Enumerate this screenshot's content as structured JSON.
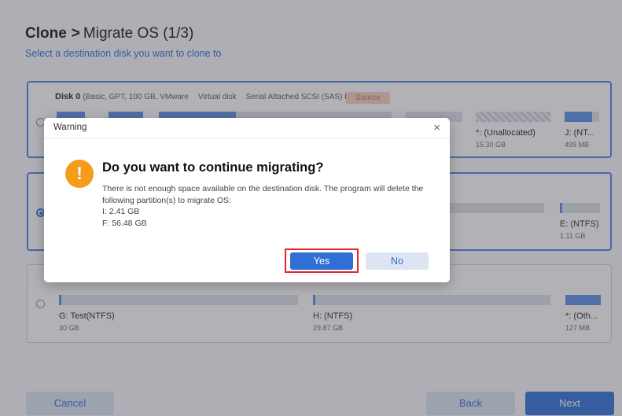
{
  "header": {
    "title_bold": "Clone",
    "arrow": ">",
    "title_rest": "Migrate OS (1/3)",
    "subtitle": "Select a destination disk you want to clone to"
  },
  "disks": [
    {
      "name": "Disk 0",
      "details": "(Basic, GPT, 100 GB, VMware",
      "type": "Virtual disk",
      "bus": "Serial Attached SCSI (SAS) bus)",
      "badge": "Source",
      "partitions": [
        {
          "label": "*: (Unallocated)",
          "size": "15.30 GB"
        },
        {
          "label": "J: (NT...",
          "size": "499 MB"
        }
      ]
    },
    {
      "partitions": [
        {
          "label": "E: (NTFS)",
          "size": "1.11 GB"
        }
      ]
    },
    {
      "partitions": [
        {
          "label": "G: Test(NTFS)",
          "size": "30 GB"
        },
        {
          "label": "H: (NTFS)",
          "size": "29.87 GB"
        },
        {
          "label": "*: (Oth...",
          "size": "127 MB"
        }
      ]
    }
  ],
  "footer": {
    "cancel": "Cancel",
    "back": "Back",
    "next": "Next"
  },
  "dialog": {
    "title": "Warning",
    "close": "×",
    "icon": "exclamation-icon",
    "icon_glyph": "!",
    "heading": "Do you want to continue migrating?",
    "message": "There is not enough space available on the destination disk. The program will delete the following partition(s) to migrate OS:",
    "partitions": [
      "I: 2.41 GB",
      "F: 56.48 GB"
    ],
    "yes": "Yes",
    "no": "No"
  },
  "colors": {
    "accent": "#2f6fd6",
    "warning": "#f59d1a",
    "highlight": "#e0262c"
  }
}
